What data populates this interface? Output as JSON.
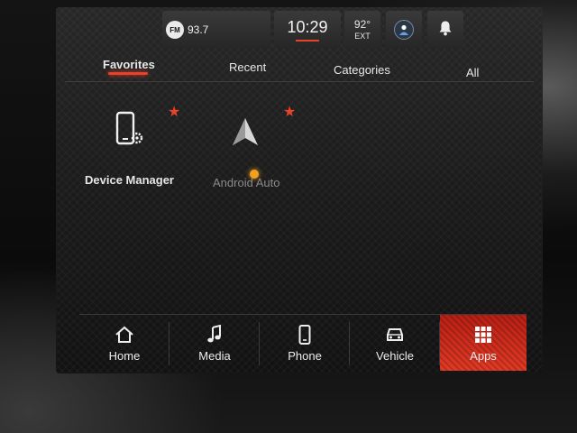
{
  "status_bar": {
    "radio_badge": "FM",
    "radio_frequency": "93.7",
    "time": "10:29",
    "temperature": "92°",
    "temperature_label": "EXT",
    "driver_icon": "driver-profile-icon",
    "bell_icon": "notification-bell-icon"
  },
  "tabs": [
    {
      "label": "Favorites",
      "active": true
    },
    {
      "label": "Recent",
      "active": false
    },
    {
      "label": "Categories",
      "active": false
    },
    {
      "label": "All",
      "active": false
    }
  ],
  "apps": [
    {
      "label": "Device Manager",
      "icon": "phone-gear-icon",
      "favorite": true
    },
    {
      "label": "Android Auto",
      "icon": "android-auto-icon",
      "favorite": true
    }
  ],
  "nav": [
    {
      "label": "Home",
      "icon": "home-icon",
      "active": false
    },
    {
      "label": "Media",
      "icon": "music-note-icon",
      "active": false
    },
    {
      "label": "Phone",
      "icon": "phone-icon",
      "active": false
    },
    {
      "label": "Vehicle",
      "icon": "car-icon",
      "active": false
    },
    {
      "label": "Apps",
      "icon": "apps-grid-icon",
      "active": true
    }
  ],
  "colors": {
    "accent": "#e8412c",
    "active_nav": "#d42f1e",
    "text": "#e6e6e6"
  }
}
